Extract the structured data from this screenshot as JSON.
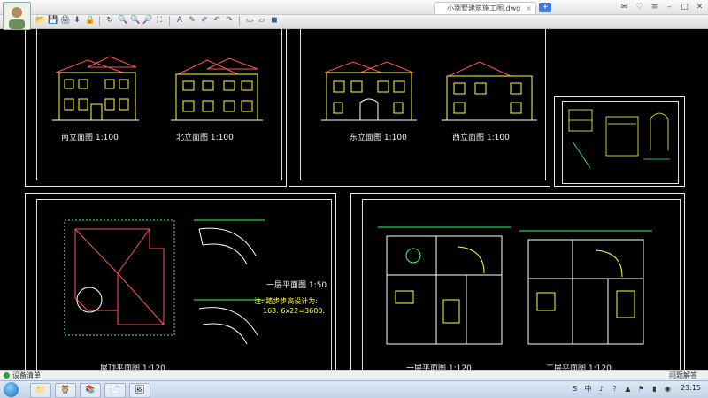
{
  "window": {
    "tab_title": "小别墅建筑施工图.dwg",
    "tab_close": "×",
    "new_tab": "+"
  },
  "title_controls": [
    "✉",
    "♡",
    "≡",
    "–",
    "□",
    "✕"
  ],
  "toolbar": [
    "📂",
    "💾",
    "🖨",
    "⬇",
    "🔒",
    "↻",
    "🔍",
    "🔍",
    "🔎",
    "⛶",
    "A",
    "✎",
    "✐",
    "↶",
    "↷",
    "▭",
    "▱",
    "◼"
  ],
  "drawings": {
    "elev_south": "南立面图 1:100",
    "elev_north": "北立面图 1:100",
    "elev_east": "东立面图 1:100",
    "elev_west": "西立面图 1:100",
    "roof_plan": "屋顶平面图 1:120",
    "stair_plan_title": "一层平面图 1:50",
    "stair_note_1": "注: 踏步步高设计为:",
    "stair_note_2": "163. 6x22=3600.",
    "floor1": "一层平面图 1:120",
    "floor2": "二层平面图 1:120"
  },
  "status": {
    "left": "设备清单",
    "right": "问题解答"
  },
  "taskbar": {
    "tasks": [
      "📁",
      "🦉",
      "📚",
      "📄",
      "🖼"
    ],
    "tray": [
      "S",
      "中",
      "♪",
      "?",
      "▲",
      "⚑",
      "▮",
      "◉"
    ],
    "time": "23:15"
  }
}
